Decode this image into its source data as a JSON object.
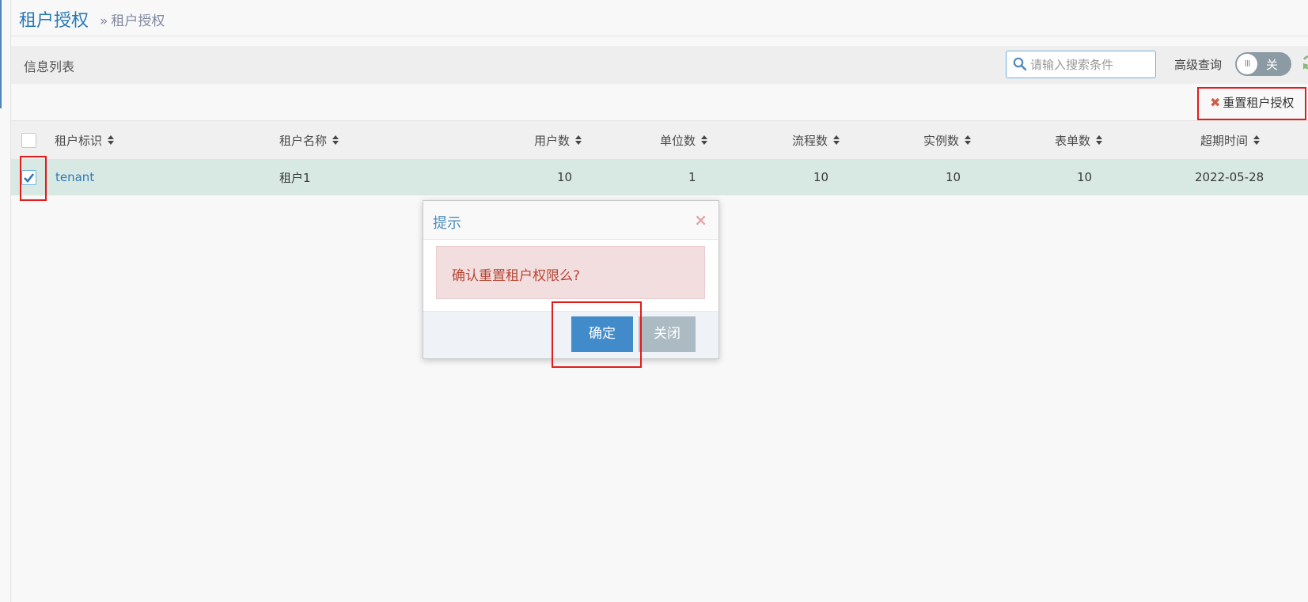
{
  "header": {
    "title": "租户授权",
    "breadcrumb_sep": "»",
    "breadcrumb": "租户授权"
  },
  "toolbar": {
    "list_title": "信息列表",
    "search_placeholder": "请输入搜索条件",
    "advanced_label": "高级查询",
    "toggle_knob": "III",
    "toggle_state": "关",
    "reset_label": "重置租户授权"
  },
  "table": {
    "columns": [
      "租户标识",
      "租户名称",
      "用户数",
      "单位数",
      "流程数",
      "实例数",
      "表单数",
      "超期时间"
    ],
    "rows": [
      {
        "id": "tenant",
        "name": "租户1",
        "users": "10",
        "units": "1",
        "flows": "10",
        "instances": "10",
        "forms": "10",
        "expire": "2022-05-28"
      }
    ]
  },
  "modal": {
    "title": "提示",
    "close": "×",
    "message": "确认重置租户权限么?",
    "ok_label": "确定",
    "cancel_label": "关闭"
  },
  "colors": {
    "accent": "#428bca",
    "highlight": "#e21b1b",
    "row_selected": "#d8e9e3",
    "alert_bg": "#f2dede"
  },
  "icons": [
    "search-icon",
    "refresh-icon",
    "close-icon",
    "checkbox-checked-icon",
    "sort-icon"
  ]
}
